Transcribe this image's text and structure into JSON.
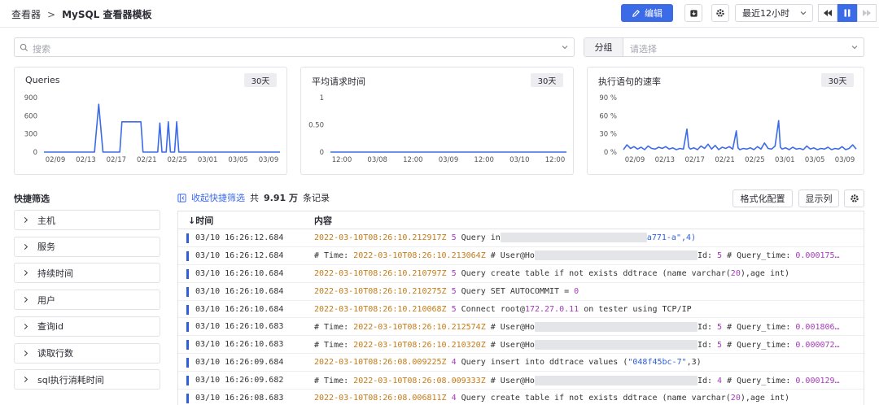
{
  "header": {
    "breadcrumb_root": "查看器",
    "breadcrumb_sep": ">",
    "breadcrumb_current": "MySQL 查看器模板",
    "edit_label": "编辑",
    "time_range": "最近12小时",
    "accent": "#3c6be8"
  },
  "search": {
    "placeholder": "搜索"
  },
  "group": {
    "label": "分组",
    "placeholder": "请选择"
  },
  "charts": [
    {
      "title": "Queries",
      "range_label": "30天",
      "chart_data": {
        "type": "line",
        "title": "Queries",
        "y_ticks": [
          "900",
          "600",
          "300",
          "0"
        ],
        "x_ticks": [
          "02/09",
          "02/13",
          "02/17",
          "02/21",
          "02/25",
          "03/01",
          "03/05",
          "03/09"
        ],
        "ylim": [
          0,
          900
        ],
        "series": [
          {
            "points": [
              [
                0,
                0
              ],
              [
                12,
                0
              ],
              [
                13,
                790
              ],
              [
                14,
                0
              ],
              [
                18,
                0
              ],
              [
                18.5,
                500
              ],
              [
                23,
                500
              ],
              [
                23.5,
                0
              ],
              [
                27,
                0
              ],
              [
                27.5,
                480
              ],
              [
                28,
                0
              ],
              [
                29,
                0
              ],
              [
                29.5,
                500
              ],
              [
                30,
                0
              ],
              [
                31,
                0
              ],
              [
                31.5,
                500
              ],
              [
                32,
                0
              ],
              [
                56,
                0
              ]
            ]
          }
        ],
        "color": "#3c6be8"
      }
    },
    {
      "title": "平均请求时间",
      "range_label": "30天",
      "chart_data": {
        "type": "line",
        "title": "平均请求时间",
        "y_ticks": [
          "1",
          "0.50",
          "0"
        ],
        "x_ticks": [
          "12:00",
          "03/08",
          "12:00",
          "03/09",
          "12:00",
          "03/10",
          "12:00"
        ],
        "ylim": [
          0,
          1
        ],
        "series": [
          {
            "points": [
              [
                0,
                0
              ],
              [
                100,
                0
              ]
            ]
          }
        ],
        "color": "#3c6be8"
      }
    },
    {
      "title": "执行语句的速率",
      "range_label": "30天",
      "chart_data": {
        "type": "line",
        "title": "执行语句的速率",
        "y_ticks": [
          "90 %",
          "60 %",
          "30 %",
          "0 %"
        ],
        "x_ticks": [
          "02/09",
          "02/13",
          "02/17",
          "02/21",
          "02/25",
          "03/01",
          "03/05",
          "03/09"
        ],
        "ylim": [
          0,
          90
        ],
        "series": [
          {
            "points": [
              [
                0,
                4
              ],
              [
                1,
                12
              ],
              [
                2,
                6
              ],
              [
                3,
                9
              ],
              [
                4,
                5
              ],
              [
                5,
                8
              ],
              [
                6,
                4
              ],
              [
                7,
                10
              ],
              [
                8,
                6
              ],
              [
                9,
                5
              ],
              [
                10,
                8
              ],
              [
                11,
                6
              ],
              [
                12,
                9
              ],
              [
                13,
                5
              ],
              [
                14,
                7
              ],
              [
                15,
                4
              ],
              [
                16,
                6
              ],
              [
                17,
                5
              ],
              [
                18,
                38
              ],
              [
                18.5,
                8
              ],
              [
                19,
                5
              ],
              [
                20,
                7
              ],
              [
                21,
                4
              ],
              [
                22,
                10
              ],
              [
                23,
                6
              ],
              [
                24,
                13
              ],
              [
                25,
                5
              ],
              [
                26,
                11
              ],
              [
                27,
                4
              ],
              [
                28,
                8
              ],
              [
                29,
                6
              ],
              [
                30,
                9
              ],
              [
                31,
                5
              ],
              [
                32,
                35
              ],
              [
                32.5,
                7
              ],
              [
                33,
                4
              ],
              [
                34,
                6
              ],
              [
                35,
                5
              ],
              [
                36,
                7
              ],
              [
                37,
                4
              ],
              [
                38,
                9
              ],
              [
                39,
                5
              ],
              [
                40,
                15
              ],
              [
                41,
                6
              ],
              [
                42,
                5
              ],
              [
                43,
                10
              ],
              [
                44,
                52
              ],
              [
                44.5,
                8
              ],
              [
                45,
                5
              ],
              [
                46,
                7
              ],
              [
                47,
                4
              ],
              [
                48,
                8
              ],
              [
                49,
                5
              ],
              [
                50,
                6
              ],
              [
                51,
                4
              ],
              [
                52,
                10
              ],
              [
                53,
                5
              ],
              [
                54,
                7
              ],
              [
                55,
                4
              ],
              [
                56,
                6
              ],
              [
                57,
                5
              ],
              [
                58,
                8
              ],
              [
                59,
                4
              ],
              [
                60,
                6
              ],
              [
                61,
                5
              ],
              [
                62,
                9
              ],
              [
                63,
                4
              ],
              [
                64,
                6
              ],
              [
                65,
                12
              ],
              [
                66,
                5
              ]
            ]
          }
        ],
        "color": "#3c6be8"
      }
    }
  ],
  "quick_filter": {
    "title": "快捷筛选",
    "items": [
      "主机",
      "服务",
      "持续时间",
      "用户",
      "查询id",
      "读取行数",
      "sql执行消耗时间"
    ]
  },
  "toolbar": {
    "collapse_label": "收起快捷筛选",
    "count_prefix": "共",
    "count_value": "9.91 万",
    "count_suffix": "条记录",
    "format_label": "格式化配置",
    "columns_label": "显示列"
  },
  "table": {
    "col_time": "↓时间",
    "col_content": "内容",
    "rows": [
      {
        "time": "03/10 16:26:12.684",
        "type": "q",
        "ts": "2022-03-10T08:26:10.212917Z",
        "n": "5",
        "text": "Query in",
        "mask": 180,
        "tail": "a771-a\",4)"
      },
      {
        "time": "03/10 16:26:12.684",
        "type": "u",
        "ts": "2022-03-10T08:26:10.213064Z",
        "text": "# User@Ho",
        "mask": 200,
        "id": "5",
        "qt": "0.000175…"
      },
      {
        "time": "03/10 16:26:10.684",
        "type": "s",
        "ts": "2022-03-10T08:26:10.210797Z",
        "n": "5",
        "pre": "Query create table if not exists ddtrace (name varchar(",
        "num2": "20",
        "post": "),age int)"
      },
      {
        "time": "03/10 16:26:10.684",
        "type": "s",
        "ts": "2022-03-10T08:26:10.210275Z",
        "n": "5",
        "pre": "Query SET AUTOCOMMIT = ",
        "num2": "0",
        "post": ""
      },
      {
        "time": "03/10 16:26:10.684",
        "type": "c",
        "ts": "2022-03-10T08:26:10.210068Z",
        "n": "5",
        "pre": "Connect root@",
        "num2": "172.27.0.11",
        "post": " on tester using TCP/IP"
      },
      {
        "time": "03/10 16:26:10.683",
        "type": "u",
        "ts": "2022-03-10T08:26:10.212574Z",
        "text": "# User@Ho",
        "mask": 200,
        "id": "5",
        "qt": "0.001806…"
      },
      {
        "time": "03/10 16:26:10.683",
        "type": "u",
        "ts": "2022-03-10T08:26:10.210320Z",
        "text": "# User@Ho",
        "mask": 200,
        "id": "5",
        "qt": "0.000072…"
      },
      {
        "time": "03/10 16:26:09.684",
        "type": "i",
        "ts": "2022-03-10T08:26:08.009225Z",
        "n": "4",
        "pre": "Query insert into ddtrace values (",
        "str": "\"048f45bc-7\"",
        "post": ",3)"
      },
      {
        "time": "03/10 16:26:09.682",
        "type": "u",
        "ts": "2022-03-10T08:26:08.009333Z",
        "text": "# User@Ho",
        "mask": 200,
        "id": "4",
        "qt": "0.000129…"
      },
      {
        "time": "03/10 16:26:08.683",
        "type": "s",
        "ts": "2022-03-10T08:26:08.006811Z",
        "n": "4",
        "pre": "Query create table if not exists ddtrace (name varchar(",
        "num2": "20",
        "post": "),age int)"
      }
    ]
  }
}
